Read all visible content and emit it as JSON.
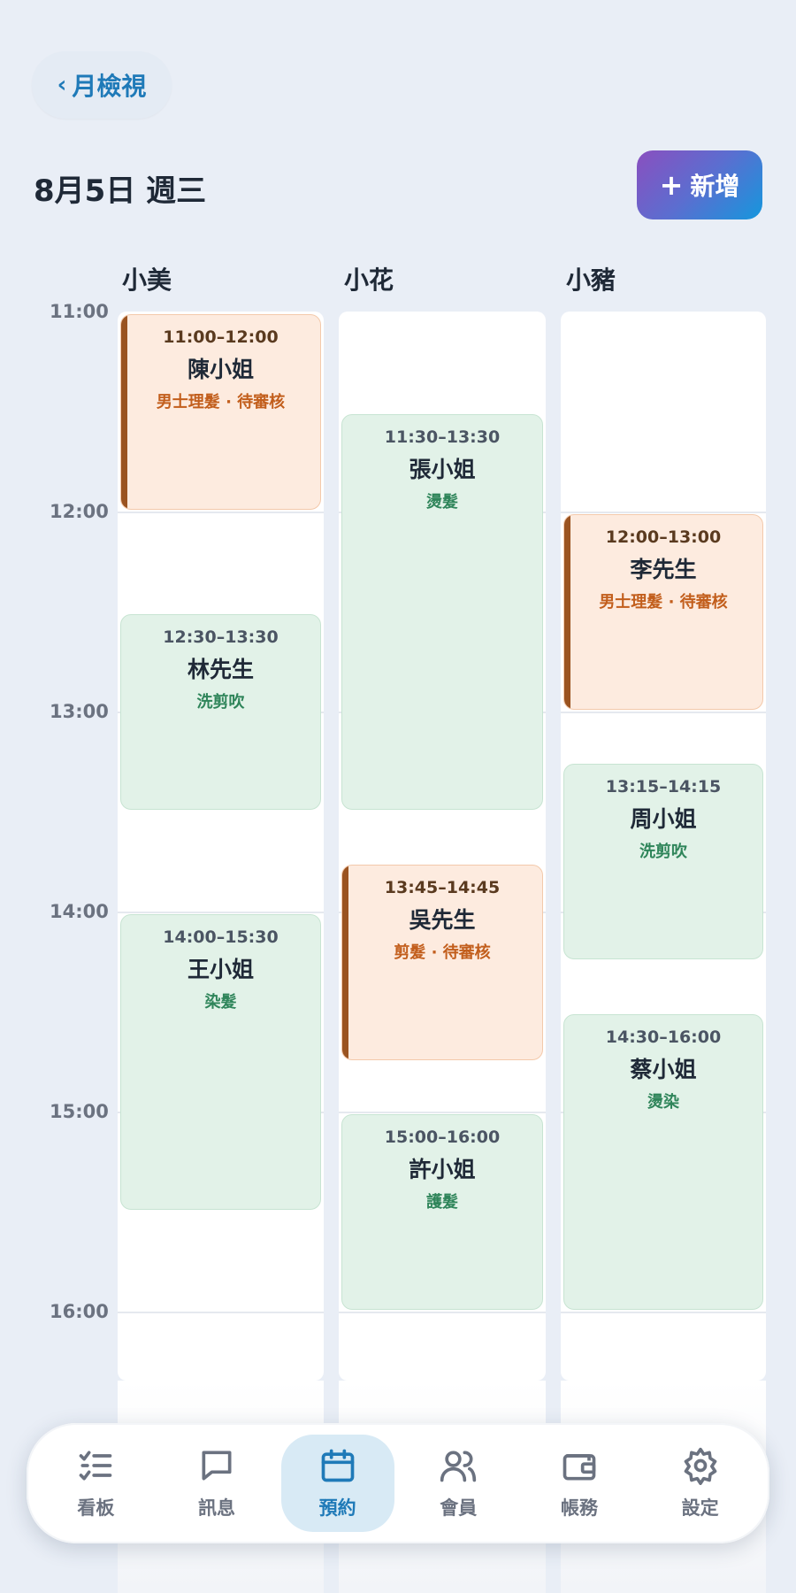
{
  "header": {
    "back_label": "月檢視",
    "back_chevron": "‹",
    "date_title": "8月5日 週三",
    "add_label": "新增",
    "add_plus": "+"
  },
  "columns": [
    {
      "name": "小美"
    },
    {
      "name": "小花"
    },
    {
      "name": "小豬"
    }
  ],
  "time_labels": [
    "11:00",
    "12:00",
    "13:00",
    "14:00",
    "15:00",
    "16:00"
  ],
  "appointments": {
    "c0a": {
      "time": "11:00–12:00",
      "name": "陳小姐",
      "service": "男士理髮 · 待審核",
      "status": "pending"
    },
    "c0b": {
      "time": "12:30–13:30",
      "name": "林先生",
      "service": "洗剪吹",
      "status": "done"
    },
    "c0c": {
      "time": "14:00–15:30",
      "name": "王小姐",
      "service": "染髮",
      "status": "done"
    },
    "c1a": {
      "time": "11:30–13:30",
      "name": "張小姐",
      "service": "燙髮",
      "status": "done"
    },
    "c1b": {
      "time": "13:45–14:45",
      "name": "吳先生",
      "service": "剪髮 · 待審核",
      "status": "pending"
    },
    "c1c": {
      "time": "15:00–16:00",
      "name": "許小姐",
      "service": "護髮",
      "status": "done"
    },
    "c2a": {
      "time": "12:00–13:00",
      "name": "李先生",
      "service": "男士理髮 · 待審核",
      "status": "pending"
    },
    "c2b": {
      "time": "13:15–14:15",
      "name": "周小姐",
      "service": "洗剪吹",
      "status": "done"
    },
    "c2c": {
      "time": "14:30–16:00",
      "name": "蔡小姐",
      "service": "燙染",
      "status": "done"
    }
  },
  "nav": {
    "items": [
      {
        "label": "看板",
        "icon": "checklist-icon"
      },
      {
        "label": "訊息",
        "icon": "chat-bubble-icon"
      },
      {
        "label": "預約",
        "icon": "calendar-icon",
        "active": true
      },
      {
        "label": "會員",
        "icon": "users-icon"
      },
      {
        "label": "帳務",
        "icon": "wallet-icon"
      },
      {
        "label": "設定",
        "icon": "gear-icon"
      }
    ]
  },
  "colors": {
    "accent": "#1f7ab8",
    "pending_bg": "#fdebdf",
    "pending_bar": "#9a5320",
    "done_bg": "#e2f2e8",
    "service_done": "#2f855a",
    "service_pending": "#c25e1c"
  }
}
